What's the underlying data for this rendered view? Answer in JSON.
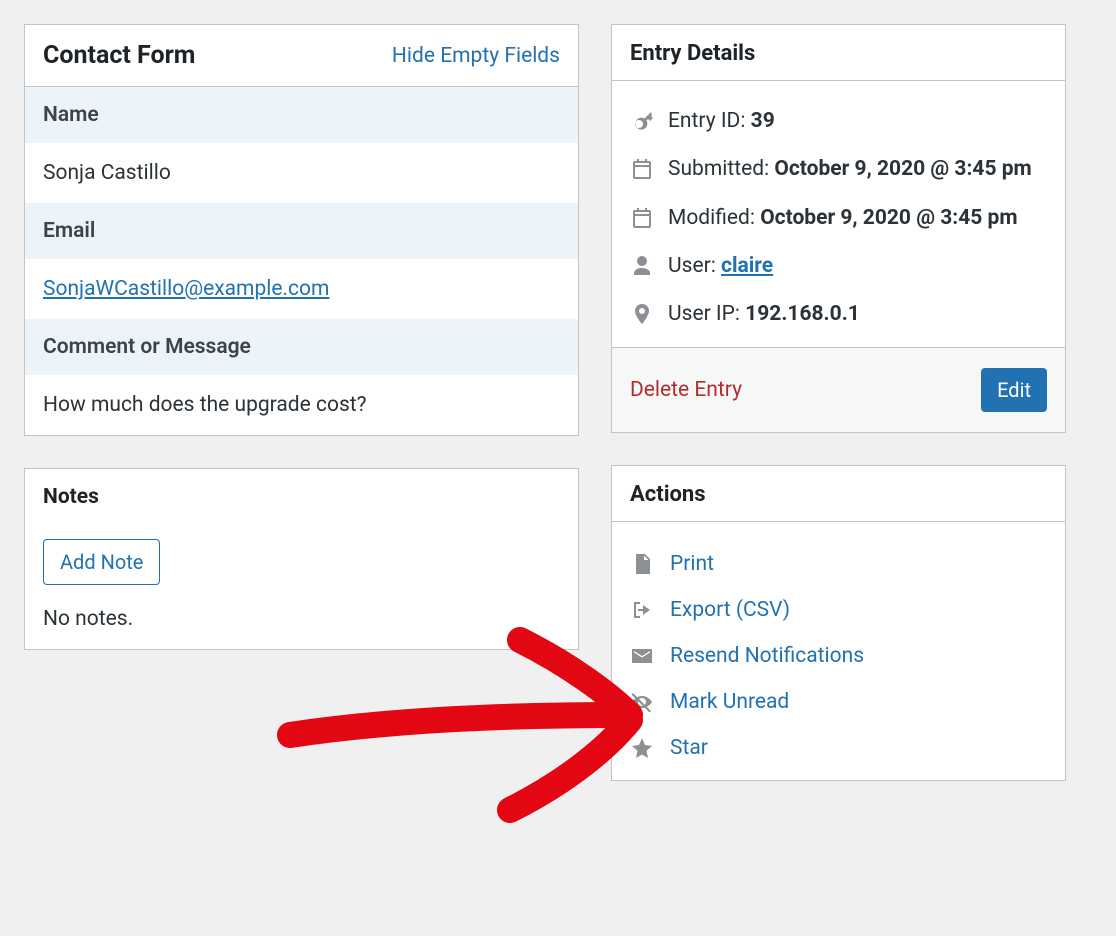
{
  "contactForm": {
    "title": "Contact Form",
    "hideEmptyFields": "Hide Empty Fields",
    "fields": {
      "nameLabel": "Name",
      "nameValue": "Sonja Castillo",
      "emailLabel": "Email",
      "emailValue": "SonjaWCastillo@example.com",
      "commentLabel": "Comment or Message",
      "commentValue": "How much does the upgrade cost?"
    }
  },
  "notes": {
    "title": "Notes",
    "addNote": "Add Note",
    "empty": "No notes."
  },
  "entryDetails": {
    "title": "Entry Details",
    "entryIdLabel": "Entry ID: ",
    "entryIdValue": "39",
    "submittedLabel": "Submitted: ",
    "submittedValue": "October 9, 2020 @ 3:45 pm",
    "modifiedLabel": "Modified: ",
    "modifiedValue": "October 9, 2020 @ 3:45 pm",
    "userLabel": "User: ",
    "userValue": "claire",
    "userIpLabel": "User IP: ",
    "userIpValue": "192.168.0.1",
    "delete": "Delete Entry",
    "edit": "Edit"
  },
  "actions": {
    "title": "Actions",
    "print": "Print",
    "export": "Export (CSV)",
    "resend": "Resend Notifications",
    "markUnread": "Mark Unread",
    "star": "Star"
  }
}
